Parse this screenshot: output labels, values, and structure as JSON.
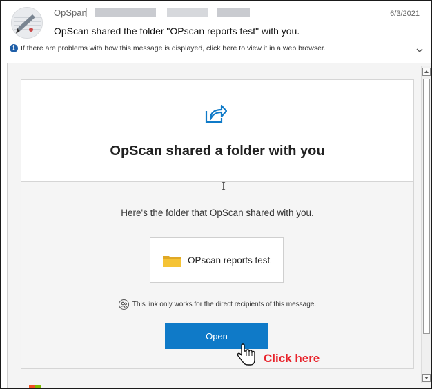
{
  "header": {
    "sender": "OpSpan",
    "date": "6/3/2021",
    "subject": "OpScan shared the folder \"OPscan reports test\" with you.",
    "info_text": "If there are problems with how this message is displayed, click here to view it in a web browser."
  },
  "card": {
    "title": "OpScan shared a folder with you",
    "description": "Here's the folder that OpScan shared with you.",
    "folder_name": "OPscan reports test",
    "note": "This link only works for the direct recipients of this message.",
    "open_label": "Open"
  },
  "annotation": {
    "click_here": "Click here"
  },
  "colors": {
    "accent": "#0f7ac8",
    "annotation_red": "#e8232b",
    "folder_yellow": "#f5c335"
  },
  "icons": [
    "share-icon",
    "folder-icon",
    "info-icon",
    "people-icon",
    "hand-cursor-icon",
    "chevron-down-icon"
  ]
}
